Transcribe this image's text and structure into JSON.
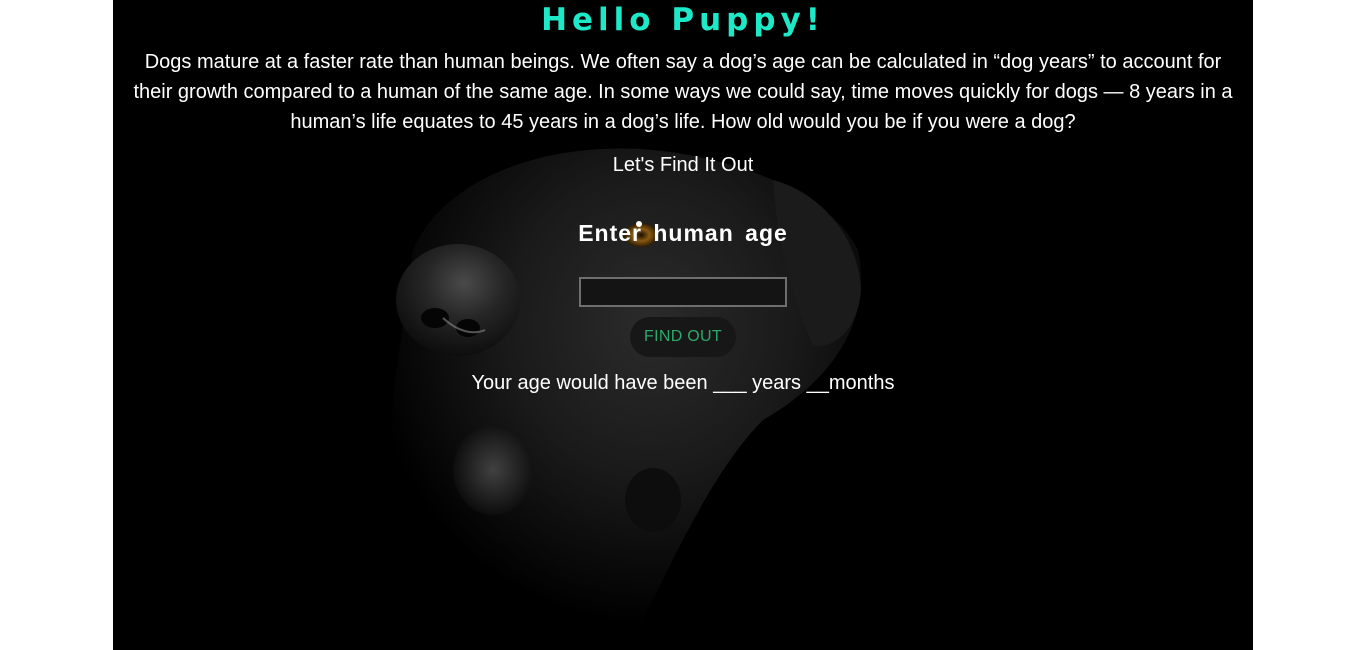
{
  "header": {
    "title": "Hello Puppy!",
    "title_color": "#1de9c9"
  },
  "intro": {
    "text": "Dogs mature at a faster rate than human beings. We often say a dog’s age can be calculated in “dog years” to account for their growth compared to a human of the same age. In some ways we could say, time moves quickly for dogs — 8 years in a human’s life equates to 45 years in a dog’s life. How old would you be if you were a dog?"
  },
  "cta": {
    "text": "Let's Find It Out"
  },
  "form": {
    "prompt": "Enter human age",
    "input_value": "",
    "button_label": "FIND OUT",
    "button_color": "#2ea86a"
  },
  "result": {
    "text": "Your age would have been ___ years __months"
  },
  "background": {
    "image": "dog-photo"
  }
}
